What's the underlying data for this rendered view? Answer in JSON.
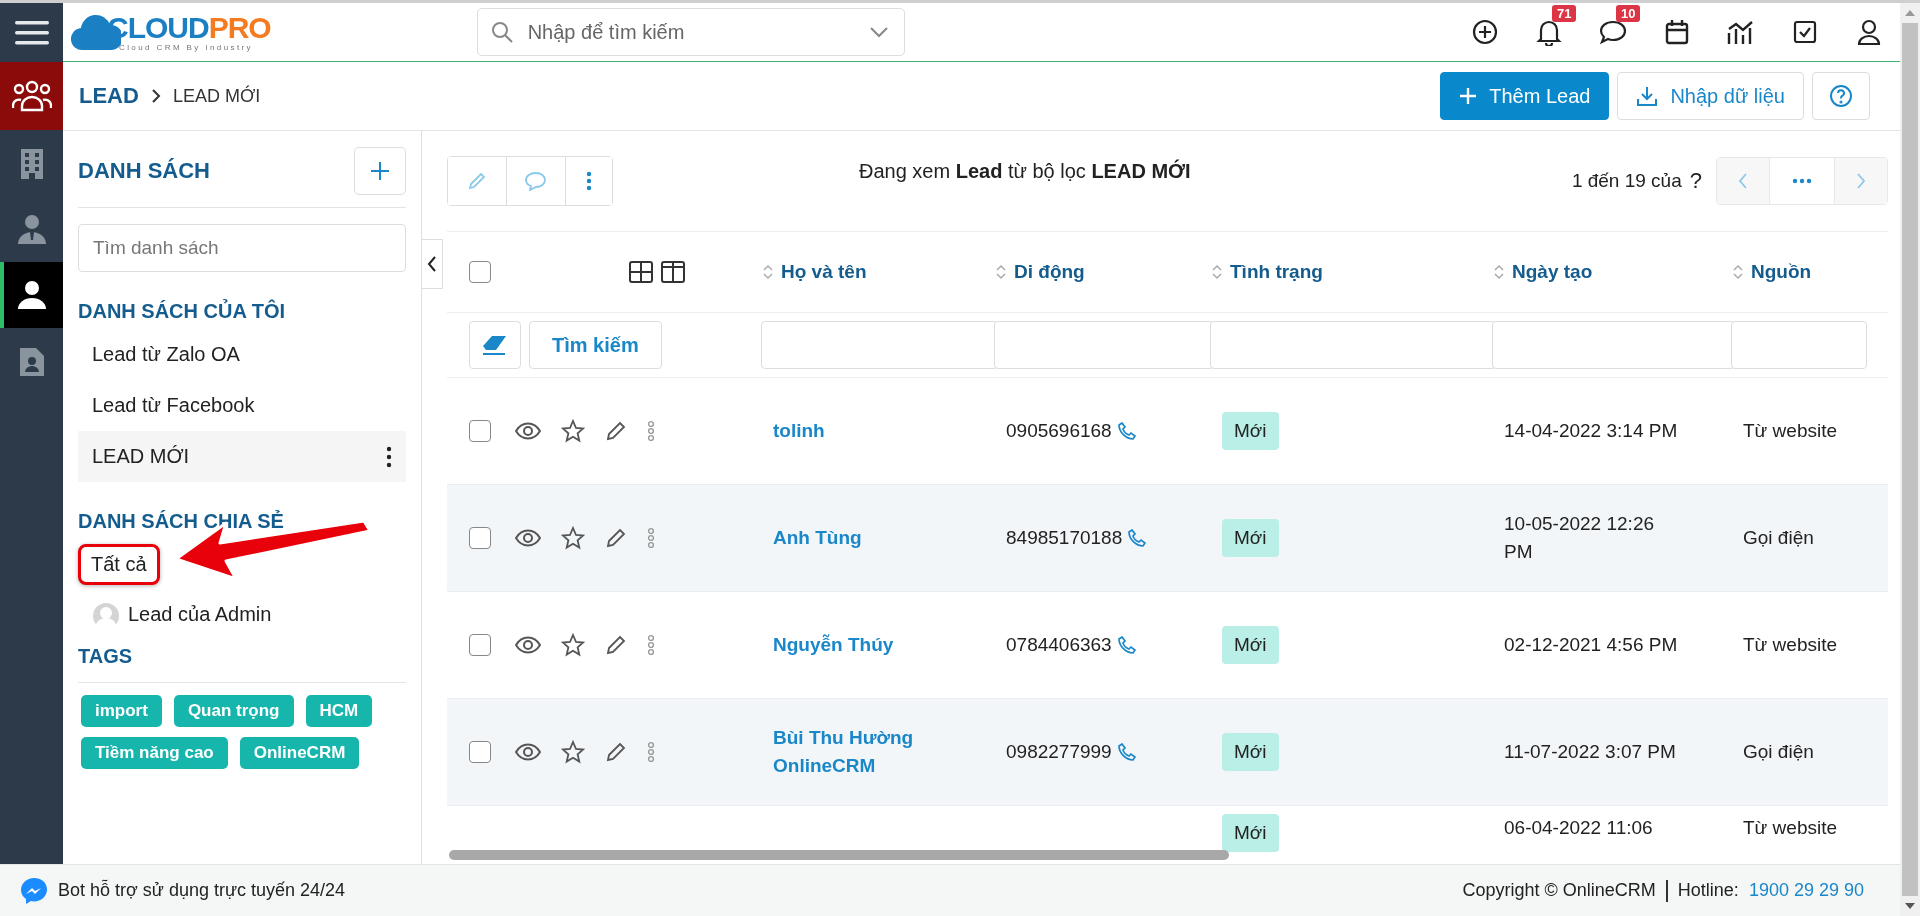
{
  "logo": {
    "part_1": "CLOUD",
    "part_2": "PRO",
    "tagline": "Cloud CRM By Industry"
  },
  "search": {
    "placeholder": "Nhập để tìm kiếm"
  },
  "header_icons": [
    {
      "kind": "add"
    },
    {
      "kind": "bell",
      "badge": "71"
    },
    {
      "kind": "chat",
      "badge": "10"
    },
    {
      "kind": "calendar"
    },
    {
      "kind": "chart"
    },
    {
      "kind": "task"
    },
    {
      "kind": "user"
    }
  ],
  "rail": [
    {
      "kind": "module",
      "selected": false
    },
    {
      "kind": "building",
      "selected": false
    },
    {
      "kind": "agent",
      "selected": false
    },
    {
      "kind": "person",
      "selected": true
    },
    {
      "kind": "document",
      "selected": false
    }
  ],
  "breadcrumb": [
    "LEAD",
    "LEAD MỚI"
  ],
  "actions": [
    {
      "kind": "primary",
      "label": "Thêm Lead"
    },
    {
      "kind": "import",
      "label": "Nhập dữ liệu"
    },
    {
      "kind": "help"
    }
  ],
  "sidebar": {
    "title": "DANH SÁCH",
    "search_placeholder": "Tìm danh sách",
    "my_lists": {
      "title": "DANH SÁCH CỦA TÔI",
      "items": [
        {
          "label": "Lead từ Zalo OA",
          "selected": false
        },
        {
          "label": "Lead từ Facebook",
          "selected": false
        },
        {
          "label": "LEAD MỚI",
          "selected": true
        }
      ]
    },
    "shared": {
      "title": "DANH SÁCH CHIA SẺ",
      "items": [
        {
          "kind": "plain",
          "label": "Tất cả",
          "highlighted": true
        },
        {
          "kind": "user",
          "label": "Lead của Admin",
          "highlighted": false
        }
      ]
    },
    "tags": {
      "title": "TAGS",
      "items": [
        "import",
        "Quan trọng",
        "HCM",
        "Tiềm năng cao",
        "OnlineCRM"
      ]
    }
  },
  "toolbar": {
    "summary": "Đang xem **Lead** từ bộ lọc **LEAD MỚI**",
    "range": "1 đến 19 của",
    "total": "?"
  },
  "table": {
    "select_all_checked": false,
    "columns": [
      "Họ và tên",
      "Di động",
      "Tình trạng",
      "Ngày tạo",
      "Nguồn"
    ],
    "search_button": "Tìm kiếm",
    "rows": [
      {
        "kind": "full",
        "checked": false,
        "name": "tolinh",
        "phone": "0905696168",
        "status": "Mới",
        "created": "14-04-2022 3:14 PM",
        "source": "Từ website"
      },
      {
        "kind": "full",
        "checked": false,
        "name": "Anh Tùng",
        "phone": "84985170188",
        "status": "Mới",
        "created": "10-05-2022 12:26 PM",
        "source": "Gọi điện"
      },
      {
        "kind": "full",
        "checked": false,
        "name": "Nguyễn Thúy",
        "phone": "0784406363",
        "status": "Mới",
        "created": "02-12-2021 4:56 PM",
        "source": "Từ website"
      },
      {
        "kind": "full",
        "checked": false,
        "name": "Bùi Thu Hường OnlineCRM",
        "phone": "0982277999",
        "status": "Mới",
        "created": "11-07-2022 3:07 PM",
        "source": "Gọi điện"
      },
      {
        "kind": "partial",
        "status": "Mới",
        "created": "06-04-2022 11:06",
        "source": "Từ website"
      }
    ]
  },
  "footer": {
    "bot": "Bot hỗ trợ sử dụng trực tuyến 24/24",
    "copyright": "Copyright © OnlineCRM",
    "hotline_label": "Hotline:",
    "hotline": "1900 29 29 90"
  }
}
